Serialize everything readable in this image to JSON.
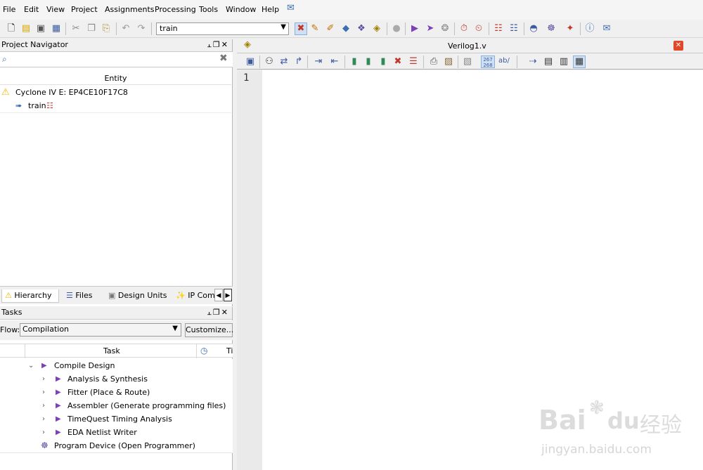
{
  "menu": {
    "items": [
      "File",
      "Edit",
      "View",
      "Project",
      "Assignments",
      "Processing",
      "Tools",
      "Window",
      "Help"
    ]
  },
  "toolbar": {
    "revision_value": "train"
  },
  "project_navigator": {
    "title": "Project Navigator",
    "entity_header": "Entity",
    "device": "Cyclone IV E: EP4CE10F17C8",
    "top_entity": "train",
    "tabs": [
      "Hierarchy",
      "Files",
      "Design Units",
      "IP Comp"
    ]
  },
  "tasks": {
    "title": "Tasks",
    "flow_label": "Flow:",
    "flow_value": "Compilation",
    "customize_label": "Customize...",
    "column_task": "Task",
    "column_time_abbrev": "Ti",
    "rows": [
      "Compile Design",
      "Analysis & Synthesis",
      "Fitter (Place & Route)",
      "Assembler (Generate programming files)",
      "TimeQuest Timing Analysis",
      "EDA Netlist Writer",
      "Program Device (Open Programmer)"
    ]
  },
  "editor": {
    "filename": "Verilog1.v",
    "line_number": "1",
    "toolbar_num_badge": "267 268",
    "toolbar_ab": "ab/"
  },
  "watermark": {
    "brand": "Bai",
    "brand2": "du",
    "chinese": "经验",
    "url": "jingyan.baidu.com"
  },
  "colors": {
    "accent_purple": "#7b3fb8",
    "close_red": "#e0482a",
    "warning_yellow": "#e8b800"
  }
}
